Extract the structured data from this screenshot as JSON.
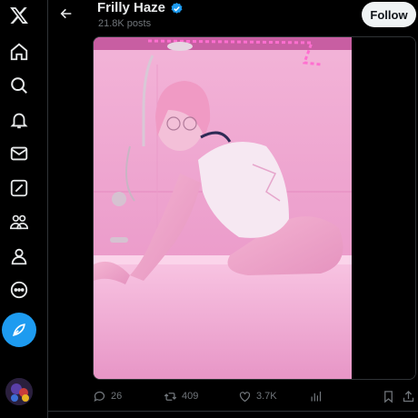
{
  "header": {
    "profile_name": "Frilly Haze",
    "post_count": "21.8K posts",
    "follow_label": "Follow"
  },
  "nav": {
    "items": [
      "x-logo-icon",
      "home-icon",
      "search-icon",
      "notifications-icon",
      "messages-icon",
      "grok-icon",
      "communities-icon",
      "profile-icon",
      "more-icon"
    ],
    "compose_icon": "compose-icon"
  },
  "actions": {
    "replies": "26",
    "reposts": "409",
    "likes": "3.7K"
  },
  "colors": {
    "accent": "#1d9bf0",
    "background": "#000000",
    "muted": "#71767b",
    "photo_pink": "#f0a8d0"
  }
}
